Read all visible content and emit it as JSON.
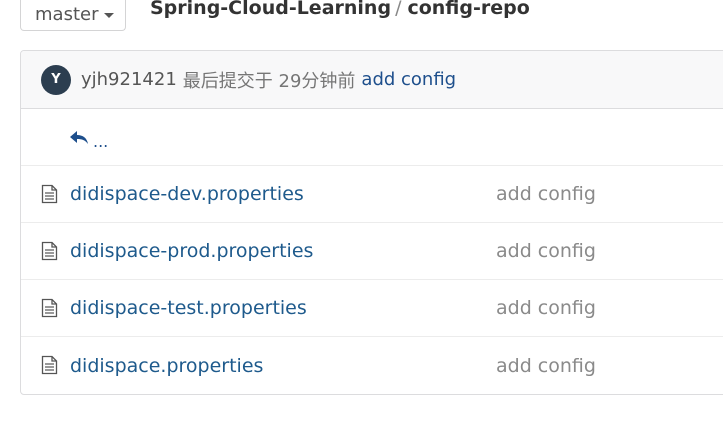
{
  "branch": {
    "label": "master"
  },
  "breadcrumb": {
    "repo": "Spring-Cloud-Learning",
    "separator": "/",
    "folder": "config-repo"
  },
  "latest_commit": {
    "avatar_letter": "Y",
    "user": "yjh921421",
    "meta": "最后提交于 29分钟前",
    "message": "add config"
  },
  "parent_link": {
    "label": "..."
  },
  "files": [
    {
      "name": "didispace-dev.properties",
      "commit": "add config"
    },
    {
      "name": "didispace-prod.properties",
      "commit": "add config"
    },
    {
      "name": "didispace-test.properties",
      "commit": "add config"
    },
    {
      "name": "didispace.properties",
      "commit": "add config"
    }
  ],
  "colors": {
    "link": "#1e5a8c",
    "avatar_bg": "#2c3e50",
    "muted": "#8a8a8a"
  }
}
